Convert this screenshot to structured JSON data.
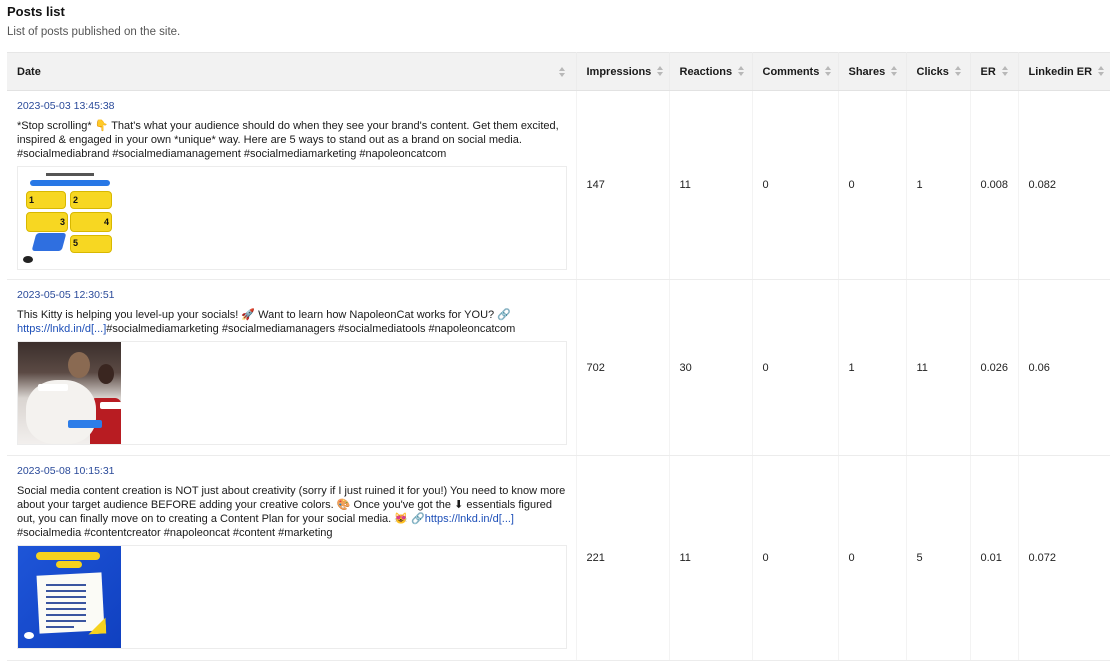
{
  "header": {
    "title": "Posts list",
    "subtitle": "List of posts published on the site."
  },
  "table": {
    "columns": [
      {
        "label": "Date",
        "icon": "sort-icon"
      },
      {
        "label": "Impressions",
        "icon": "sort-icon"
      },
      {
        "label": "Reactions",
        "icon": "sort-icon"
      },
      {
        "label": "Comments",
        "icon": "sort-icon"
      },
      {
        "label": "Shares",
        "icon": "sort-icon"
      },
      {
        "label": "Clicks",
        "icon": "sort-icon"
      },
      {
        "label": "ER",
        "icon": "sort-icon"
      },
      {
        "label": "Linkedin ER",
        "icon": "sort-icon"
      }
    ],
    "rows": [
      {
        "date": "2023-05-03 13:45:38",
        "text": "*Stop scrolling* 👇 That's what your audience should do when they see your brand's content. Get them excited, inspired & engaged in your own *unique* way. Here are 5 ways to stand out as a brand on social media. #socialmediabrand #socialmediamanagement #socialmediamarketing #napoleoncatcom",
        "text_after_link": "",
        "link": "",
        "image": "5 ways to stand out as a brand on social media infographic",
        "impressions": "147",
        "reactions": "11",
        "comments": "0",
        "shares": "0",
        "clicks": "1",
        "er": "0.008",
        "linkedin_er": "0.082"
      },
      {
        "date": "2023-05-05 12:30:51",
        "text": "This Kitty is helping you level-up your socials! 🚀 Want to learn how NapoleonCat works for YOU? 🔗 ",
        "link": "https://lnkd.in/d[...]",
        "text_after_link": "#socialmediamarketing #socialmediamanagers #socialmediatools #napoleoncatcom",
        "image": "Cat costume meme photo",
        "impressions": "702",
        "reactions": "30",
        "comments": "0",
        "shares": "1",
        "clicks": "11",
        "er": "0.026",
        "linkedin_er": "0.06"
      },
      {
        "date": "2023-05-08 10:15:31",
        "text": "Social media content creation is NOT just about creativity (sorry if I just ruined it for you!) You need to know more about your target audience BEFORE adding your creative colors. 🎨 Once you've got the ⬇ essentials figured out, you can finally move on to creating a Content Plan for your social media. 😻 🔗",
        "link": "https://lnkd.in/d[...]",
        "text_after_link": " #socialmedia #contentcreator #napoleoncat #content #marketing",
        "image": "Consider this before posting checklist",
        "impressions": "221",
        "reactions": "11",
        "comments": "0",
        "shares": "0",
        "clicks": "5",
        "er": "0.01",
        "linkedin_er": "0.072"
      }
    ]
  },
  "colors": {
    "date_text": "#2a4a9a",
    "link": "#1d4fb8",
    "header_bg": "#f2f2f2"
  }
}
